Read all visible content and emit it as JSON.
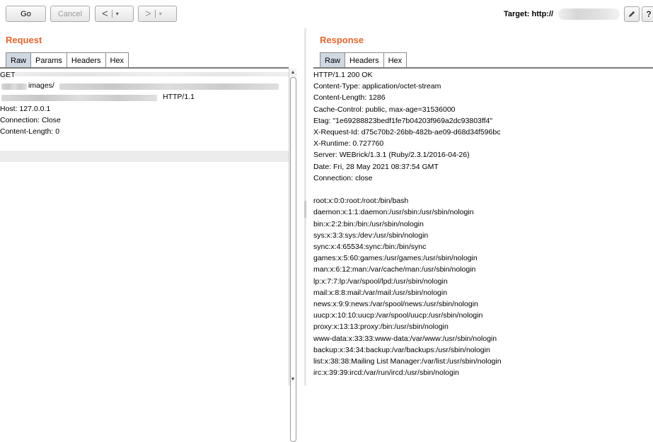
{
  "toolbar": {
    "go": "Go",
    "cancel": "Cancel",
    "back_arrow": "<",
    "fwd_arrow": ">",
    "caret": "▾",
    "target_label": "Target: http://",
    "edit_icon": "pencil-icon",
    "help_icon": "?"
  },
  "request": {
    "title": "Request",
    "tabs": [
      "Raw",
      "Params",
      "Headers",
      "Hex"
    ],
    "lines": [
      "GET",
      "images/",
      "HTTP/1.1",
      "Host: 127.0.0.1",
      "Connection: Close",
      "Content-Length: 0"
    ]
  },
  "response": {
    "title": "Response",
    "tabs": [
      "Raw",
      "Headers",
      "Hex"
    ],
    "lines": [
      "HTTP/1.1 200 OK",
      "Content-Type: application/octet-stream",
      "Content-Length: 1286",
      "Cache-Control: public, max-age=31536000",
      "Etag: \"1e69288823bedf1fe7b04203f969a2dc93803ff4\"",
      "X-Request-Id: d75c70b2-26bb-482b-ae09-d68d34f596bc",
      "X-Runtime: 0.727760",
      "Server: WEBrick/1.3.1 (Ruby/2.3.1/2016-04-26)",
      "Date: Fri, 28 May 2021 08:37:54 GMT",
      "Connection: close",
      "",
      "root:x:0:0:root:/root:/bin/bash",
      "daemon:x:1:1:daemon:/usr/sbin:/usr/sbin/nologin",
      "bin:x:2:2:bin:/bin:/usr/sbin/nologin",
      "sys:x:3:3:sys:/dev:/usr/sbin/nologin",
      "sync:x:4:65534:sync:/bin:/bin/sync",
      "games:x:5:60:games:/usr/games:/usr/sbin/nologin",
      "man:x:6:12:man:/var/cache/man:/usr/sbin/nologin",
      "lp:x:7:7:lp:/var/spool/lpd:/usr/sbin/nologin",
      "mail:x:8:8:mail:/var/mail:/usr/sbin/nologin",
      "news:x:9:9:news:/var/spool/news:/usr/sbin/nologin",
      "uucp:x:10:10:uucp:/var/spool/uucp:/usr/sbin/nologin",
      "proxy:x:13:13:proxy:/bin:/usr/sbin/nologin",
      "www-data:x:33:33:www-data:/var/www:/usr/sbin/nologin",
      "backup:x:34:34:backup:/var/backups:/usr/sbin/nologin",
      "list:x:38:38:Mailing List Manager:/var/list:/usr/sbin/nologin",
      "irc:x:39:39:ircd:/var/run/ircd:/usr/sbin/nologin"
    ]
  },
  "colors": {
    "title_orange": "#e8662c",
    "active_tab": "#cfd8e3"
  }
}
